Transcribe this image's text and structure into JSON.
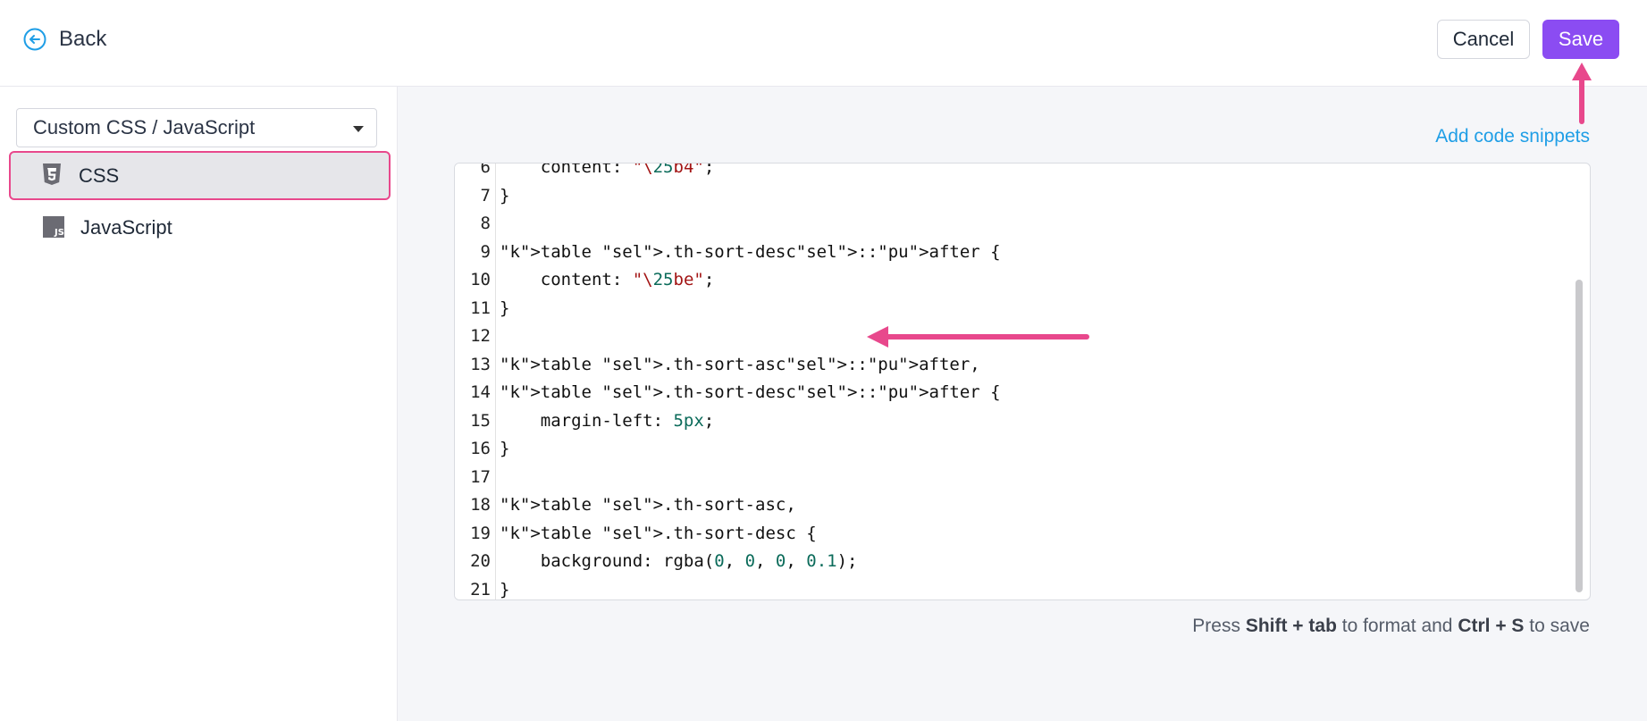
{
  "header": {
    "back_label": "Back",
    "cancel_label": "Cancel",
    "save_label": "Save"
  },
  "sidebar": {
    "select_value": "Custom CSS / JavaScript",
    "items": [
      {
        "label": "CSS",
        "icon": "css3-icon",
        "active": true
      },
      {
        "label": "JavaScript",
        "icon": "js-icon",
        "active": false
      }
    ]
  },
  "main": {
    "add_snippets_label": "Add code snippets",
    "hint": {
      "press": "Press",
      "shift_tab": "Shift + tab",
      "to_format": "to format and",
      "ctrl_s": "Ctrl + S",
      "to_save": "to save"
    }
  },
  "editor": {
    "lines": [
      {
        "n": "6",
        "text": "    content: \"\\25b4\";"
      },
      {
        "n": "7",
        "text": "}"
      },
      {
        "n": "8",
        "text": ""
      },
      {
        "n": "9",
        "text": "table .th-sort-desc::after {"
      },
      {
        "n": "10",
        "text": "    content: \"\\25be\";"
      },
      {
        "n": "11",
        "text": "}"
      },
      {
        "n": "12",
        "text": ""
      },
      {
        "n": "13",
        "text": "table .th-sort-asc::after,"
      },
      {
        "n": "14",
        "text": "table .th-sort-desc::after {"
      },
      {
        "n": "15",
        "text": "    margin-left: 5px;"
      },
      {
        "n": "16",
        "text": "}"
      },
      {
        "n": "17",
        "text": ""
      },
      {
        "n": "18",
        "text": "table .th-sort-asc,"
      },
      {
        "n": "19",
        "text": "table .th-sort-desc {"
      },
      {
        "n": "20",
        "text": "    background: rgba(0, 0, 0, 0.1);"
      },
      {
        "n": "21",
        "text": "}"
      }
    ]
  },
  "colors": {
    "accent": "#8b4cf2",
    "link": "#1f9ee6",
    "annotation": "#e8488c"
  }
}
